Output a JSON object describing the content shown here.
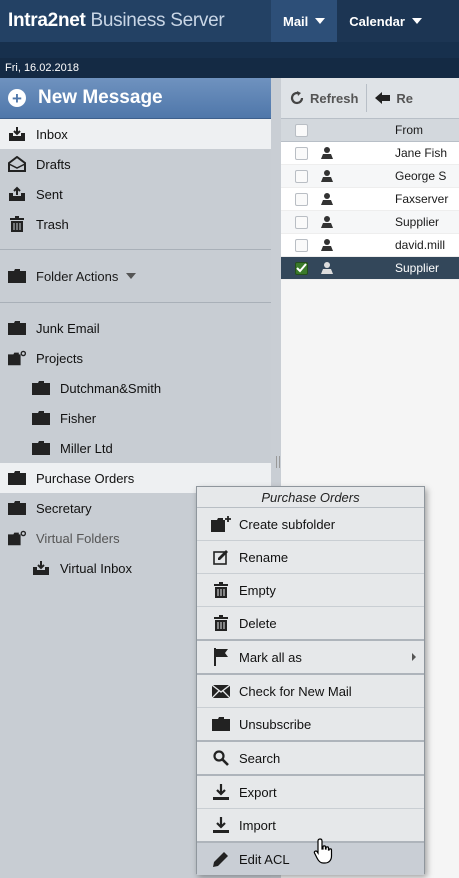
{
  "app": {
    "brand_bold": "Intra2net",
    "brand_light": "Business Server"
  },
  "nav": {
    "tabs": [
      {
        "label": "Mail"
      },
      {
        "label": "Calendar"
      }
    ]
  },
  "date": "Fri, 16.02.2018",
  "sidebar": {
    "new_message": "New Message",
    "system_folders": [
      {
        "label": "Inbox",
        "icon": "inbox-icon"
      },
      {
        "label": "Drafts",
        "icon": "drafts-icon"
      },
      {
        "label": "Sent",
        "icon": "sent-icon"
      },
      {
        "label": "Trash",
        "icon": "trash-icon"
      }
    ],
    "folder_actions": "Folder Actions",
    "folders": [
      {
        "label": "Junk Email"
      },
      {
        "label": "Projects"
      },
      {
        "label": "Dutchman&Smith"
      },
      {
        "label": "Fisher"
      },
      {
        "label": "Miller Ltd"
      },
      {
        "label": "Purchase Orders"
      },
      {
        "label": "Secretary"
      },
      {
        "label": "Virtual Folders"
      },
      {
        "label": "Virtual Inbox"
      }
    ]
  },
  "main": {
    "toolbar": {
      "refresh": "Refresh",
      "reply": "Re"
    },
    "columns": {
      "from": "From"
    },
    "rows": [
      {
        "from": "Jane Fish",
        "checked": false
      },
      {
        "from": "George S",
        "checked": false
      },
      {
        "from": "Faxserver",
        "checked": false
      },
      {
        "from": "Supplier",
        "checked": false
      },
      {
        "from": "david.mill",
        "checked": false
      },
      {
        "from": "Supplier",
        "checked": true
      }
    ]
  },
  "context_menu": {
    "title": "Purchase Orders",
    "items": [
      {
        "label": "Create subfolder"
      },
      {
        "label": "Rename"
      },
      {
        "label": "Empty"
      },
      {
        "label": "Delete"
      },
      {
        "label": "Mark all as"
      },
      {
        "label": "Check for New Mail"
      },
      {
        "label": "Unsubscribe"
      },
      {
        "label": "Search"
      },
      {
        "label": "Export"
      },
      {
        "label": "Import"
      },
      {
        "label": "Edit ACL"
      }
    ]
  }
}
